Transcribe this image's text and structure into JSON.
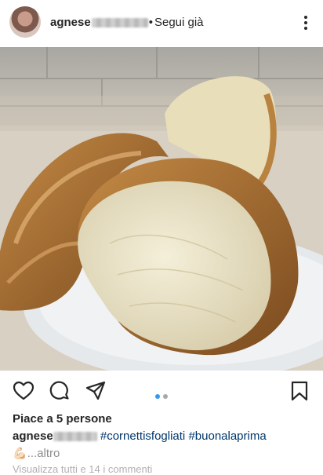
{
  "header": {
    "username": "agnese",
    "separator": "•",
    "follow_label": "Segui già",
    "menu_icon": "more-vertical-icon"
  },
  "post": {
    "image_icon": "post-photo"
  },
  "actions": {
    "like_icon": "heart-icon",
    "comment_icon": "comment-icon",
    "share_icon": "send-icon",
    "save_icon": "bookmark-icon",
    "carousel_active": 1,
    "carousel_count": 2
  },
  "likes": {
    "text": "Piace a 5 persone"
  },
  "caption": {
    "username": "agnese",
    "hashtag1": "#cornettisfogliati",
    "hashtag2": "#buonalaprima",
    "emoji": "💪🏻",
    "more": "...altro"
  },
  "comments": {
    "view_all": "Visualizza tutti e 14 i commenti"
  },
  "colors": {
    "text": "#262626",
    "hashtag": "#00376b",
    "muted": "#8e8e8e",
    "carousel_active": "#3897f0",
    "carousel_inactive": "#a8a8a8"
  }
}
